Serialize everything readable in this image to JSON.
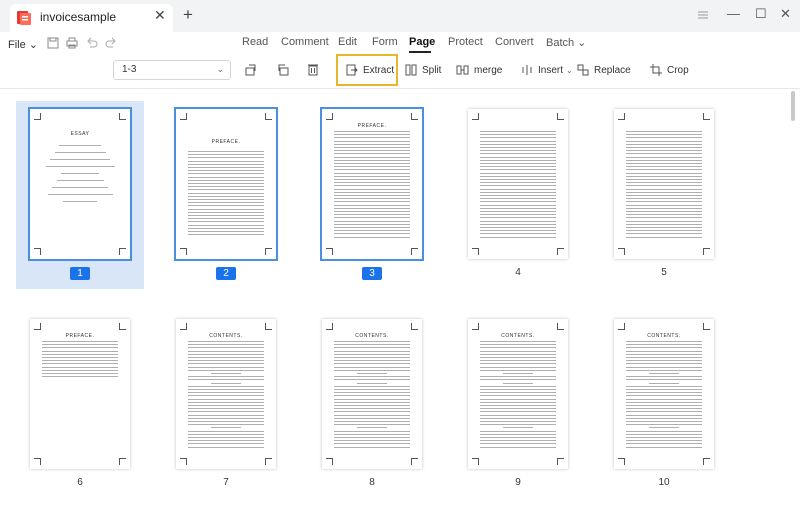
{
  "window": {
    "tab_title": "invoicesample",
    "new_tab": "+",
    "close_tab": "✕",
    "minimize": "—",
    "maximize": "☐",
    "close": "✕"
  },
  "menubar": {
    "file": "File ⌄",
    "tabs": [
      "Read",
      "Comment",
      "Edit",
      "Form",
      "Page",
      "Protect",
      "Convert",
      "Batch ⌄"
    ],
    "active_tab": "Page"
  },
  "toolbar": {
    "page_range": "1-3",
    "extract": "Extract",
    "split": "Split",
    "merge": "merge",
    "insert": "Insert",
    "replace": "Replace",
    "crop": "Crop"
  },
  "thumbnails": {
    "pages": [
      {
        "number": "1",
        "selected": true,
        "heading": "ESSAY"
      },
      {
        "number": "2",
        "selected": true,
        "heading": "PREFACE."
      },
      {
        "number": "3",
        "selected": true,
        "heading": "PREFACE."
      },
      {
        "number": "4",
        "selected": false,
        "heading": ""
      },
      {
        "number": "5",
        "selected": false,
        "heading": ""
      },
      {
        "number": "6",
        "selected": false,
        "heading": "PREFACE."
      },
      {
        "number": "7",
        "selected": false,
        "heading": "CONTENTS."
      },
      {
        "number": "8",
        "selected": false,
        "heading": "CONTENTS."
      },
      {
        "number": "9",
        "selected": false,
        "heading": "CONTENTS."
      },
      {
        "number": "10",
        "selected": false,
        "heading": "CONTENTS."
      }
    ]
  },
  "colors": {
    "accent": "#1a73e8",
    "selection_bg": "#d9e6f7",
    "highlight": "#e8b62c",
    "brand": "#e53935"
  }
}
